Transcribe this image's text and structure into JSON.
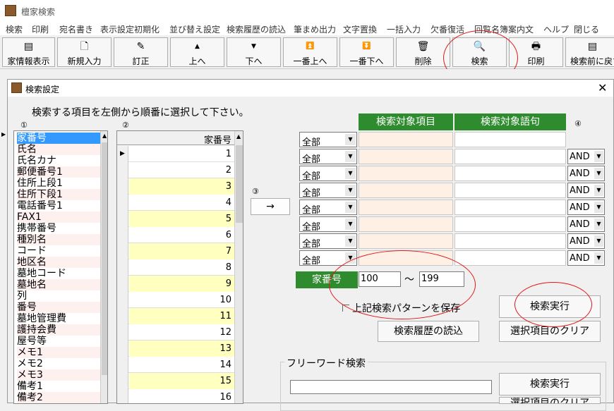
{
  "app": {
    "title": "檀家検索"
  },
  "menu": [
    "検索",
    "印刷",
    "宛名書き",
    "表示設定初期化",
    "並び替え設定",
    "検索履歴の読込",
    "筆まめ出力",
    "文字置換",
    "一括入力",
    "欠番復活",
    "回覧名簿案内文",
    "ヘルプ",
    "閉じる"
  ],
  "toolbar": [
    {
      "label": "家情報表示",
      "icon": "▤"
    },
    {
      "label": "新規入力",
      "icon": "🗋"
    },
    {
      "label": "訂正",
      "icon": "✎"
    },
    {
      "label": "上へ",
      "icon": "▲"
    },
    {
      "label": "下へ",
      "icon": "▼"
    },
    {
      "label": "一番上へ",
      "icon": "⏫"
    },
    {
      "label": "一番下へ",
      "icon": "⏬"
    },
    {
      "label": "削除",
      "icon": "🗑"
    },
    {
      "label": "検索",
      "icon": "🔍"
    },
    {
      "label": "印刷",
      "icon": "🖶"
    },
    {
      "label": "検索前に戻す",
      "icon": "▤"
    }
  ],
  "dialog": {
    "title": "検索設定",
    "close": "✕",
    "instruction": "検索する項目を左側から順番に選択して下さい。",
    "markers": [
      "①",
      "②",
      "③",
      "④"
    ],
    "list1": [
      "家番号",
      "氏名",
      "氏名カナ",
      "郵便番号1",
      "住所上段1",
      "住所下段1",
      "電話番号1",
      "FAX1",
      "携帯番号",
      "種別名",
      "コード",
      "地区名",
      "墓地コード",
      "墓地名",
      "列",
      "番号",
      "墓地管理費",
      "護持会費",
      "屋号等",
      "メモ1",
      "メモ2",
      "メモ3",
      "備考1",
      "備考2"
    ],
    "grid2": {
      "header": "家番号",
      "rows": [
        "1",
        "2",
        "3",
        "4",
        "5",
        "6",
        "7",
        "8",
        "9",
        "10",
        "11",
        "12",
        "13",
        "14",
        "15",
        "16"
      ]
    },
    "arrow": "→",
    "criteria": {
      "header_item": "検索対象項目",
      "header_word": "検索対象語句",
      "scope": [
        "全部",
        "全部",
        "全部",
        "全部",
        "全部",
        "全部",
        "全部",
        "全部"
      ],
      "logic": [
        "AND",
        "AND",
        "AND",
        "AND",
        "AND",
        "AND",
        "AND"
      ]
    },
    "range": {
      "label": "家番号",
      "from": "100",
      "sep": "〜",
      "to": "199"
    },
    "save_pattern": "上記検索パターンを保存",
    "btn_history": "検索履歴の読込",
    "btn_execute": "検索実行",
    "btn_clear": "選択項目のクリア",
    "freeword": {
      "label": "フリーワード検索",
      "btn_execute": "検索実行",
      "btn_clear": "選択項目のクリア"
    }
  }
}
